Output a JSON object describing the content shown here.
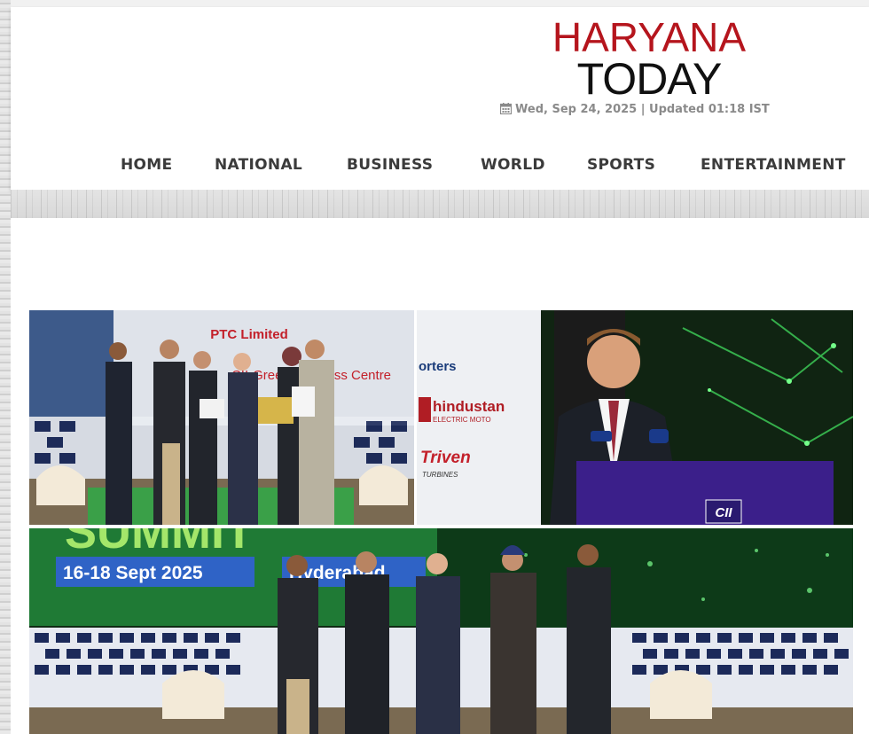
{
  "site": {
    "logo_line1": "HARYANA",
    "logo_line2": "TODAY",
    "dateline": "Wed, Sep 24, 2025 | Updated 01:18 IST"
  },
  "nav": {
    "items": [
      "HOME",
      "NATIONAL",
      "BUSINESS",
      "WORLD",
      "SPORTS",
      "ENTERTAINMENT"
    ]
  },
  "photos": {
    "award": {
      "banner_title": "PTC Limited",
      "banner_sub": "CII-Green Business Centre"
    },
    "speaker": {
      "sponsor1": "orters",
      "sponsor2": "hindustan",
      "sponsor2_sub": "ELECTRIC MOTO",
      "sponsor3": "Triven",
      "sponsor3_sub": "TURBINES",
      "podium_logo": "CII"
    },
    "group": {
      "big_text": "SUMMIT",
      "dates": "16-18 Sept 2025",
      "city": "Hyderabad"
    }
  },
  "colors": {
    "brand_red": "#b5151d",
    "nav_text": "#3b3b3b",
    "date_text": "#8a8a8a"
  },
  "icons": {
    "dateline": "calendar-icon"
  }
}
